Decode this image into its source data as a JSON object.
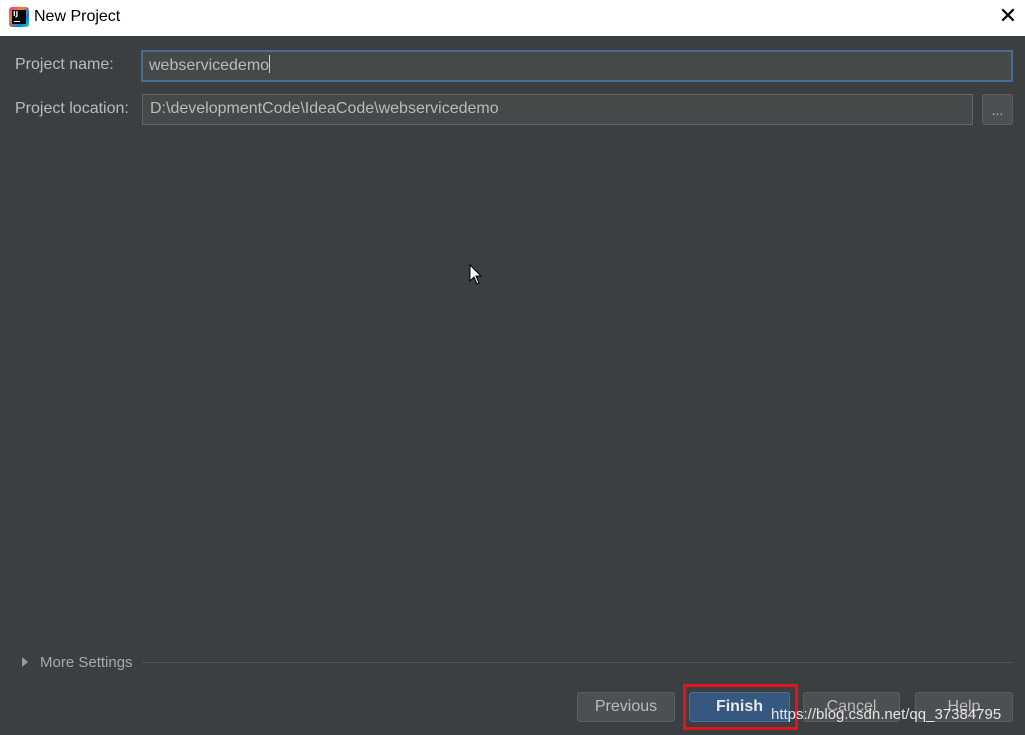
{
  "window": {
    "title": "New Project",
    "close_symbol": "✕"
  },
  "form": {
    "name_label": "Project name:",
    "name_value": "webservicedemo",
    "location_label": "Project location:",
    "location_value": "D:\\developmentCode\\IdeaCode\\webservicedemo",
    "browse_label": "..."
  },
  "more_settings": {
    "label": "More Settings",
    "expanded": false
  },
  "buttons": {
    "previous": "Previous",
    "finish": "Finish",
    "cancel": "Cancel",
    "help": "Help"
  },
  "watermark": {
    "text": "https://blog.csdn.net/qq_37384795"
  },
  "colors": {
    "background": "#3c3f41",
    "field_background": "#45494a",
    "focus_border": "#466d94",
    "default_button": "#365880",
    "highlight": "#e0141e"
  }
}
